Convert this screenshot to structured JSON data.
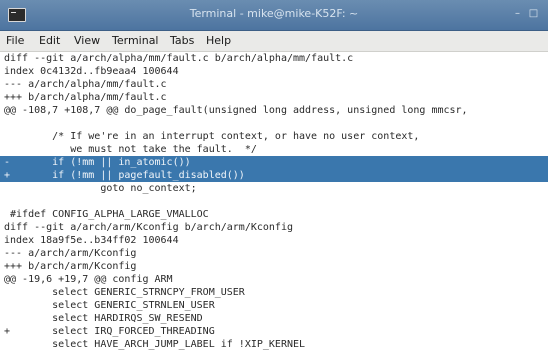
{
  "window": {
    "title": "Terminal - mike@mike-K52F: ~",
    "minimize_glyph": "–",
    "maximize_glyph": "□"
  },
  "menu": {
    "items": [
      "File",
      "Edit",
      "View",
      "Terminal",
      "Tabs",
      "Help"
    ]
  },
  "terminal": {
    "lines": [
      "diff --git a/arch/alpha/mm/fault.c b/arch/alpha/mm/fault.c",
      "index 0c4132d..fb9eaa4 100644",
      "--- a/arch/alpha/mm/fault.c",
      "+++ b/arch/alpha/mm/fault.c",
      "@@ -108,7 +108,7 @@ do_page_fault(unsigned long address, unsigned long mmcsr,",
      "",
      "        /* If we're in an interrupt context, or have no user context,",
      "           we must not take the fault.  */",
      "-       if (!mm || in_atomic())",
      "+       if (!mm || pagefault_disabled())",
      "                goto no_context;",
      "",
      " #ifdef CONFIG_ALPHA_LARGE_VMALLOC",
      "diff --git a/arch/arm/Kconfig b/arch/arm/Kconfig",
      "index 18a9f5e..b34ff02 100644",
      "--- a/arch/arm/Kconfig",
      "+++ b/arch/arm/Kconfig",
      "@@ -19,6 +19,7 @@ config ARM",
      "        select GENERIC_STRNCPY_FROM_USER",
      "        select GENERIC_STRNLEN_USER",
      "        select HARDIRQS_SW_RESEND",
      "+       select IRQ_FORCED_THREADING",
      "        select HAVE_ARCH_JUMP_LABEL if !XIP_KERNEL"
    ],
    "highlighted": [
      8,
      9
    ]
  },
  "colors": {
    "titlebar": "#4d74a0",
    "selection": "#3a77ad",
    "text": "#2a2a2a"
  }
}
